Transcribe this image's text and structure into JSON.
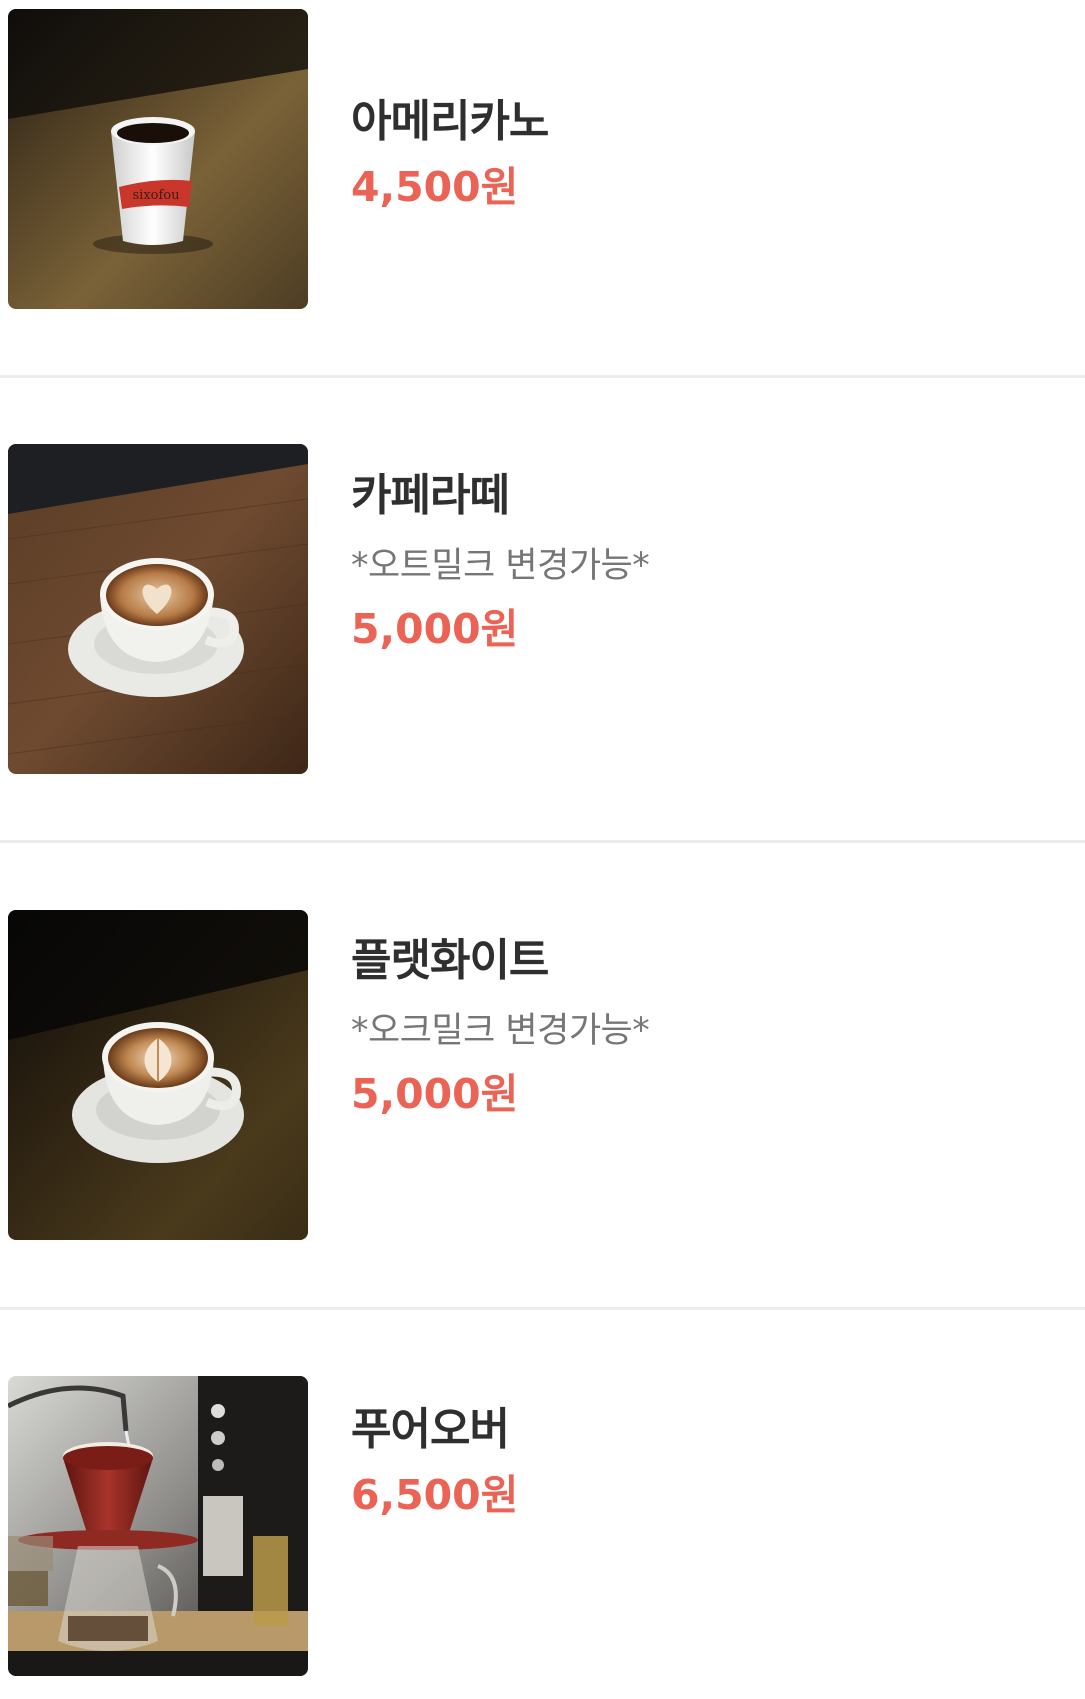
{
  "colors": {
    "price": "#ea6355",
    "name": "#2f2f2f",
    "note": "#767676",
    "divider": "#ececec"
  },
  "menu": [
    {
      "name": "아메리카노",
      "note": "",
      "price": "4,500원",
      "image": "americano-paper-cup-photo",
      "cup_text": "sixofou"
    },
    {
      "name": "카페라떼",
      "note": "*오트밀크 변경가능*",
      "price": "5,000원",
      "image": "cafe-latte-heart-art-photo"
    },
    {
      "name": "플랫화이트",
      "note": "*오크밀크 변경가능*",
      "price": "5,000원",
      "image": "flat-white-tulip-art-photo"
    },
    {
      "name": "푸어오버",
      "note": "",
      "price": "6,500원",
      "image": "pour-over-dripper-photo"
    }
  ]
}
